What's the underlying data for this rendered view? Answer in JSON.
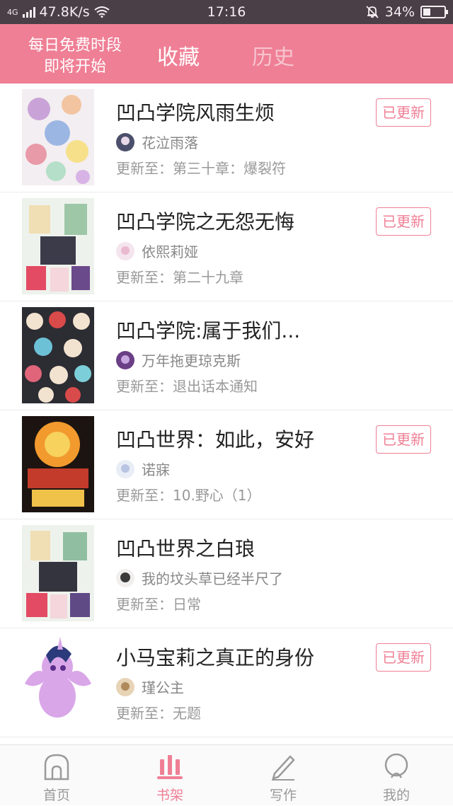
{
  "status_bar": {
    "network": "4G",
    "speed": "47.8K/s",
    "time": "17:16",
    "battery": "34%",
    "battery_level": 0.34
  },
  "top_nav": {
    "free_line1": "每日免费时段",
    "free_line2": "即将开始",
    "tab_favorites": "收藏",
    "tab_history": "历史"
  },
  "books": [
    {
      "title": "凹凸学院风雨生烦",
      "author": "花泣雨落",
      "update": "更新至：第三十章：爆裂符",
      "badge": "已更新"
    },
    {
      "title": "凹凸学院之无怨无悔",
      "author": "依熙莉娅",
      "update": "更新至：第二十九章",
      "badge": "已更新"
    },
    {
      "title": "凹凸学院:属于我们...",
      "author": "万年拖更琼克斯",
      "update": "更新至：退出话本通知",
      "badge": ""
    },
    {
      "title": "凹凸世界：如此，安好",
      "author": "诺寐",
      "update": "更新至：10.野心（1）",
      "badge": "已更新"
    },
    {
      "title": "凹凸世界之白琅",
      "author": "我的坟头草已经半尺了",
      "update": "更新至：日常",
      "badge": ""
    },
    {
      "title": "小马宝莉之真正的身份",
      "author": "瑾公主",
      "update": "更新至：无题",
      "badge": "已更新"
    }
  ],
  "bottom_nav": {
    "home": "首页",
    "bookshelf": "书架",
    "write": "写作",
    "mine": "我的"
  },
  "colors": {
    "accent": "#ef7f95",
    "status_bar": "#4a3f46"
  }
}
